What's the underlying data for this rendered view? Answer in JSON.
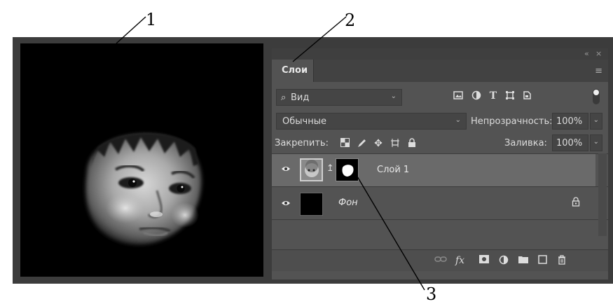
{
  "callouts": {
    "one": "1",
    "two": "2",
    "three": "3"
  },
  "panel": {
    "title_controls": {
      "collapse": "«",
      "close": "×"
    },
    "tab_label": "Слои",
    "menu_icon": "hamburger-menu-icon",
    "filter": {
      "label": "Вид",
      "icon": "search-icon"
    },
    "filter_tools": [
      "image-filter-icon",
      "adjustment-filter-icon",
      "type-filter-icon",
      "shape-filter-icon",
      "smart-object-filter-icon"
    ],
    "blend_mode": "Обычные",
    "opacity_label": "Непрозрачность:",
    "opacity_value": "100%",
    "lock_label": "Закрепить:",
    "lock_tools": [
      "lock-transparent-icon",
      "lock-image-icon",
      "lock-position-icon",
      "lock-artboard-icon",
      "lock-all-icon"
    ],
    "fill_label": "Заливка:",
    "fill_value": "100%",
    "layers": [
      {
        "name": "Слой 1",
        "visible": true,
        "selected": true,
        "has_mask": true
      },
      {
        "name": "Фон",
        "visible": true,
        "selected": false,
        "locked": true
      }
    ],
    "bottom_tools": [
      "link-layers-icon",
      "fx-icon",
      "add-mask-icon",
      "adjustment-layer-icon",
      "group-folder-icon",
      "new-layer-icon",
      "trash-icon"
    ],
    "fx_label": "fx"
  },
  "colors": {
    "panel_bg": "#535353",
    "selected_row": "#6a6a6a",
    "frame": "#3c3c3c"
  }
}
